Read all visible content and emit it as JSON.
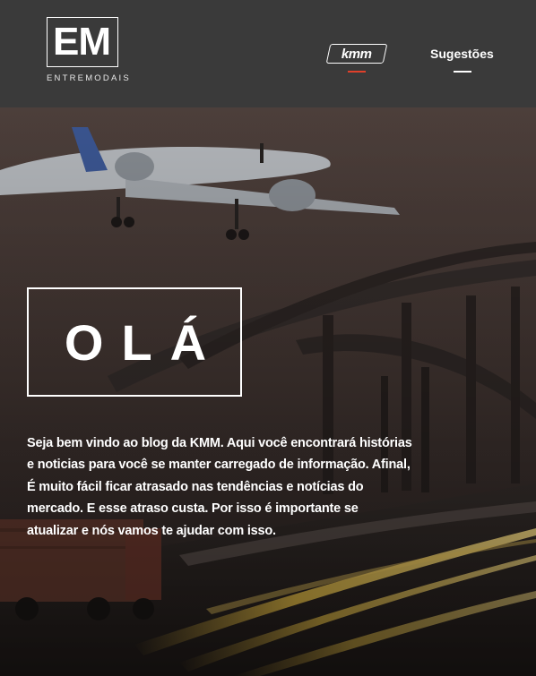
{
  "header": {
    "logo_mark": "EM",
    "logo_subtitle": "ENTREMODAIS",
    "nav": {
      "kmm_label": "kmm",
      "suggestions_label": "Sugestões"
    }
  },
  "hero": {
    "heading": "OLÁ",
    "intro": "Seja bem vindo ao blog da KMM. Aqui você encontrará histórias e noticias para você se manter carregado de informação. Afinal, É muito fácil ficar atrasado nas tendências e notícias do mercado. E esse atraso custa. Por isso é importante se atualizar e nós vamos te ajudar com isso."
  },
  "colors": {
    "header_bg": "#3a3a3a",
    "accent_underline": "#e0402a",
    "text": "#ffffff"
  }
}
